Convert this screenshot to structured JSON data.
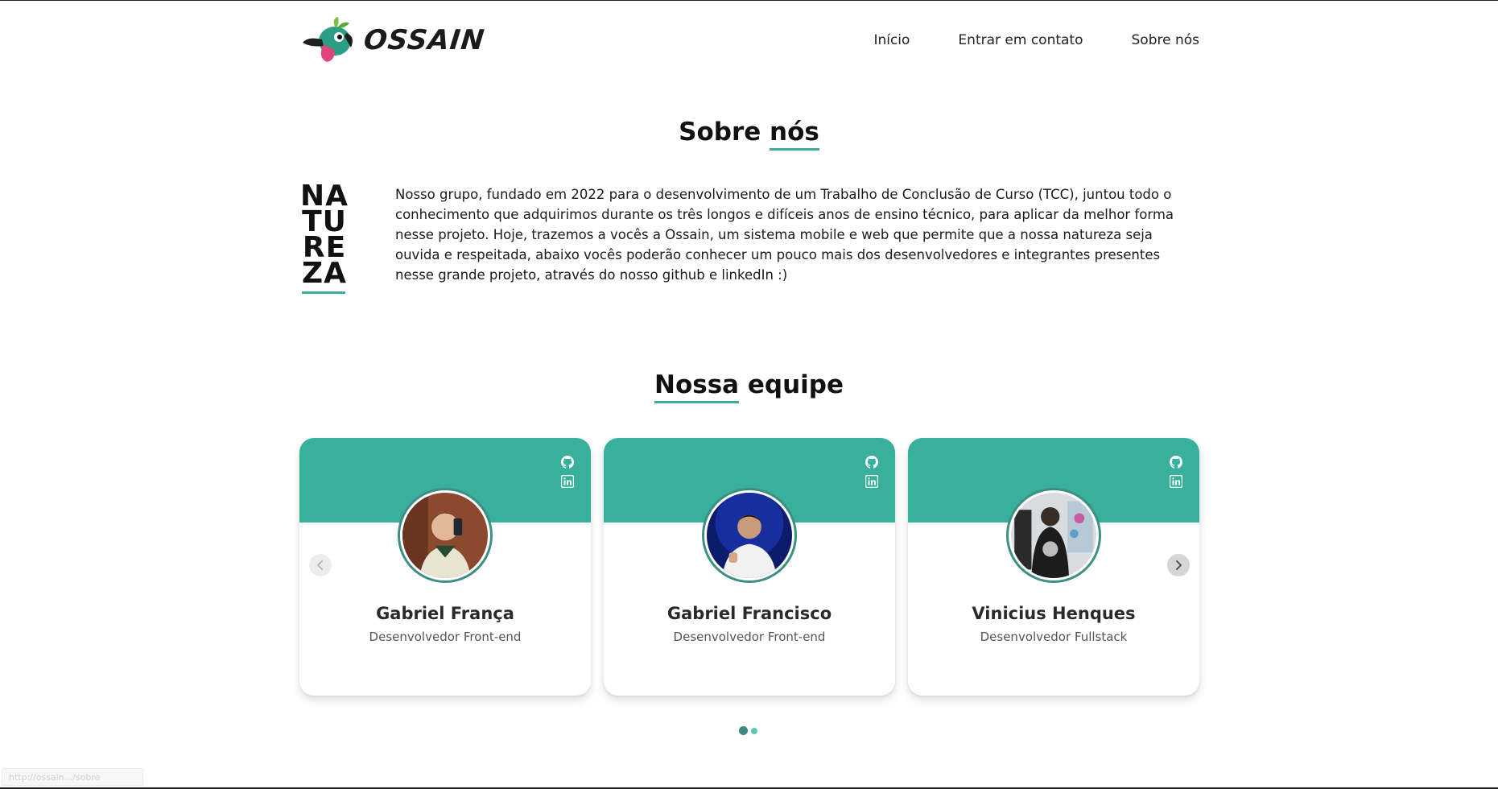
{
  "header": {
    "logo_text": "OSSAIN",
    "nav": [
      {
        "label": "Início"
      },
      {
        "label": "Entrar em contato"
      },
      {
        "label": "Sobre nós"
      }
    ]
  },
  "about": {
    "title_plain": "Sobre ",
    "title_underlined": "nós",
    "natureza_lines": [
      "NA",
      "TU",
      "RE",
      "ZA"
    ],
    "text": "Nosso grupo, fundado em 2022 para o desenvolvimento de um Trabalho de Conclusão de Curso (TCC), juntou todo o conhecimento que adquirimos durante os três longos e difíceis anos de ensino técnico, para aplicar da melhor forma nesse projeto. Hoje, trazemos a vocês a Ossain, um sistema mobile e web que permite que a nossa natureza seja ouvida e respeitada, abaixo vocês poderão conhecer um pouco mais dos desenvolvedores e integrantes presentes nesse grande projeto, através do nosso github e linkedIn :)"
  },
  "team": {
    "title_underlined": "Nossa",
    "title_plain": " equipe",
    "members": [
      {
        "name": "Gabriel França",
        "role": "Desenvolvedor Front-end"
      },
      {
        "name": "Gabriel Francisco",
        "role": "Desenvolvedor Front-end"
      },
      {
        "name": "Vinicius Henques",
        "role": "Desenvolvedor Fullstack"
      }
    ],
    "pagination": {
      "pages": 2,
      "current": 1
    }
  },
  "colors": {
    "accent": "#39b09b",
    "accent_dark": "#3d8a80",
    "text": "#111111"
  },
  "icons": {
    "card_social": [
      "github-icon",
      "linkedin-icon"
    ],
    "carousel": [
      "chevron-left-icon",
      "chevron-right-icon"
    ]
  },
  "status_bar": {
    "url": "http://ossain.../sobre"
  }
}
